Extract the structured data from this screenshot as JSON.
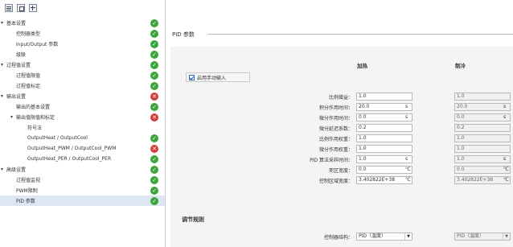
{
  "toolbar": {
    "buttons": [
      {
        "icon": "list-view-icon"
      },
      {
        "icon": "parameter-view-icon"
      },
      {
        "icon": "grid-view-icon"
      }
    ]
  },
  "tree": [
    {
      "label": "基本设置",
      "level": 0,
      "expand": "▾",
      "status": "ok"
    },
    {
      "label": "控制器类型",
      "level": 1,
      "expand": "",
      "status": "ok"
    },
    {
      "label": "Input/Output 参数",
      "level": 1,
      "expand": "",
      "status": "ok"
    },
    {
      "label": "级联",
      "level": 1,
      "expand": "",
      "status": "ok"
    },
    {
      "label": "过程值设置",
      "level": 0,
      "expand": "▾",
      "status": "ok"
    },
    {
      "label": "过程值限值",
      "level": 1,
      "expand": "",
      "status": "ok"
    },
    {
      "label": "过程值标定",
      "level": 1,
      "expand": "",
      "status": "ok"
    },
    {
      "label": "输出设置",
      "level": 0,
      "expand": "▾",
      "status": "err"
    },
    {
      "label": "输出的基本设置",
      "level": 1,
      "expand": "",
      "status": "ok"
    },
    {
      "label": "输出值限值和标定",
      "level": 1,
      "expand": "▾",
      "status": "err"
    },
    {
      "label": "符号法",
      "level": 2,
      "expand": "",
      "status": ""
    },
    {
      "label": "OutputHeat / OutputCool",
      "level": 2,
      "expand": "",
      "status": "ok"
    },
    {
      "label": "OutputHeat_PWM / OutputCool_PWM",
      "level": 2,
      "expand": "",
      "status": "err"
    },
    {
      "label": "OutputHeat_PER / OutputCool_PER",
      "level": 2,
      "expand": "",
      "status": "ok"
    },
    {
      "label": "高级设置",
      "level": 0,
      "expand": "▾",
      "status": "ok"
    },
    {
      "label": "过程值监视",
      "level": 1,
      "expand": "",
      "status": "ok"
    },
    {
      "label": "PWM限制",
      "level": 1,
      "expand": "",
      "status": "ok"
    },
    {
      "label": "PID 参数",
      "level": 1,
      "expand": "",
      "status": "ok",
      "selected": true
    }
  ],
  "status_symbols": {
    "ok": "✓",
    "err": "✕"
  },
  "section": {
    "title": "PID 参数"
  },
  "columns": {
    "heat": "加热",
    "cool": "制冷"
  },
  "manual_entry": {
    "label": "启用手动输入",
    "checked": true
  },
  "params": [
    {
      "label": "比例增益：",
      "heat": "1.0",
      "heat_unit": "",
      "cool": "1.0",
      "cool_unit": ""
    },
    {
      "label": "积分作用时间：",
      "heat": "20.0",
      "heat_unit": "s",
      "cool": "20.0",
      "cool_unit": "s"
    },
    {
      "label": "微分作用时间：",
      "heat": "0.0",
      "heat_unit": "s",
      "cool": "0.0",
      "cool_unit": "s"
    },
    {
      "label": "微分延迟系数：",
      "heat": "0.2",
      "heat_unit": "",
      "cool": "0.2",
      "cool_unit": ""
    },
    {
      "label": "比例作用权重：",
      "heat": "1.0",
      "heat_unit": "",
      "cool": "1.0",
      "cool_unit": ""
    },
    {
      "label": "微分作用权重：",
      "heat": "1.0",
      "heat_unit": "",
      "cool": "1.0",
      "cool_unit": ""
    },
    {
      "label": "PID 算法采样时间：",
      "heat": "1.0",
      "heat_unit": "s",
      "cool": "1.0",
      "cool_unit": "s"
    },
    {
      "label": "死区宽度：",
      "heat": "0.0",
      "heat_unit": "℃",
      "cool": "0.0",
      "cool_unit": "℃"
    },
    {
      "label": "控制区域宽度：",
      "heat": "3.402822E+38",
      "heat_unit": "℃",
      "cool": "3.402822E+38",
      "cool_unit": "℃"
    }
  ],
  "control_rule": {
    "title": "调节规则",
    "structure_label": "控制器结构：",
    "heat_value": "PID（温度）",
    "cool_value": "PID（温度）"
  }
}
